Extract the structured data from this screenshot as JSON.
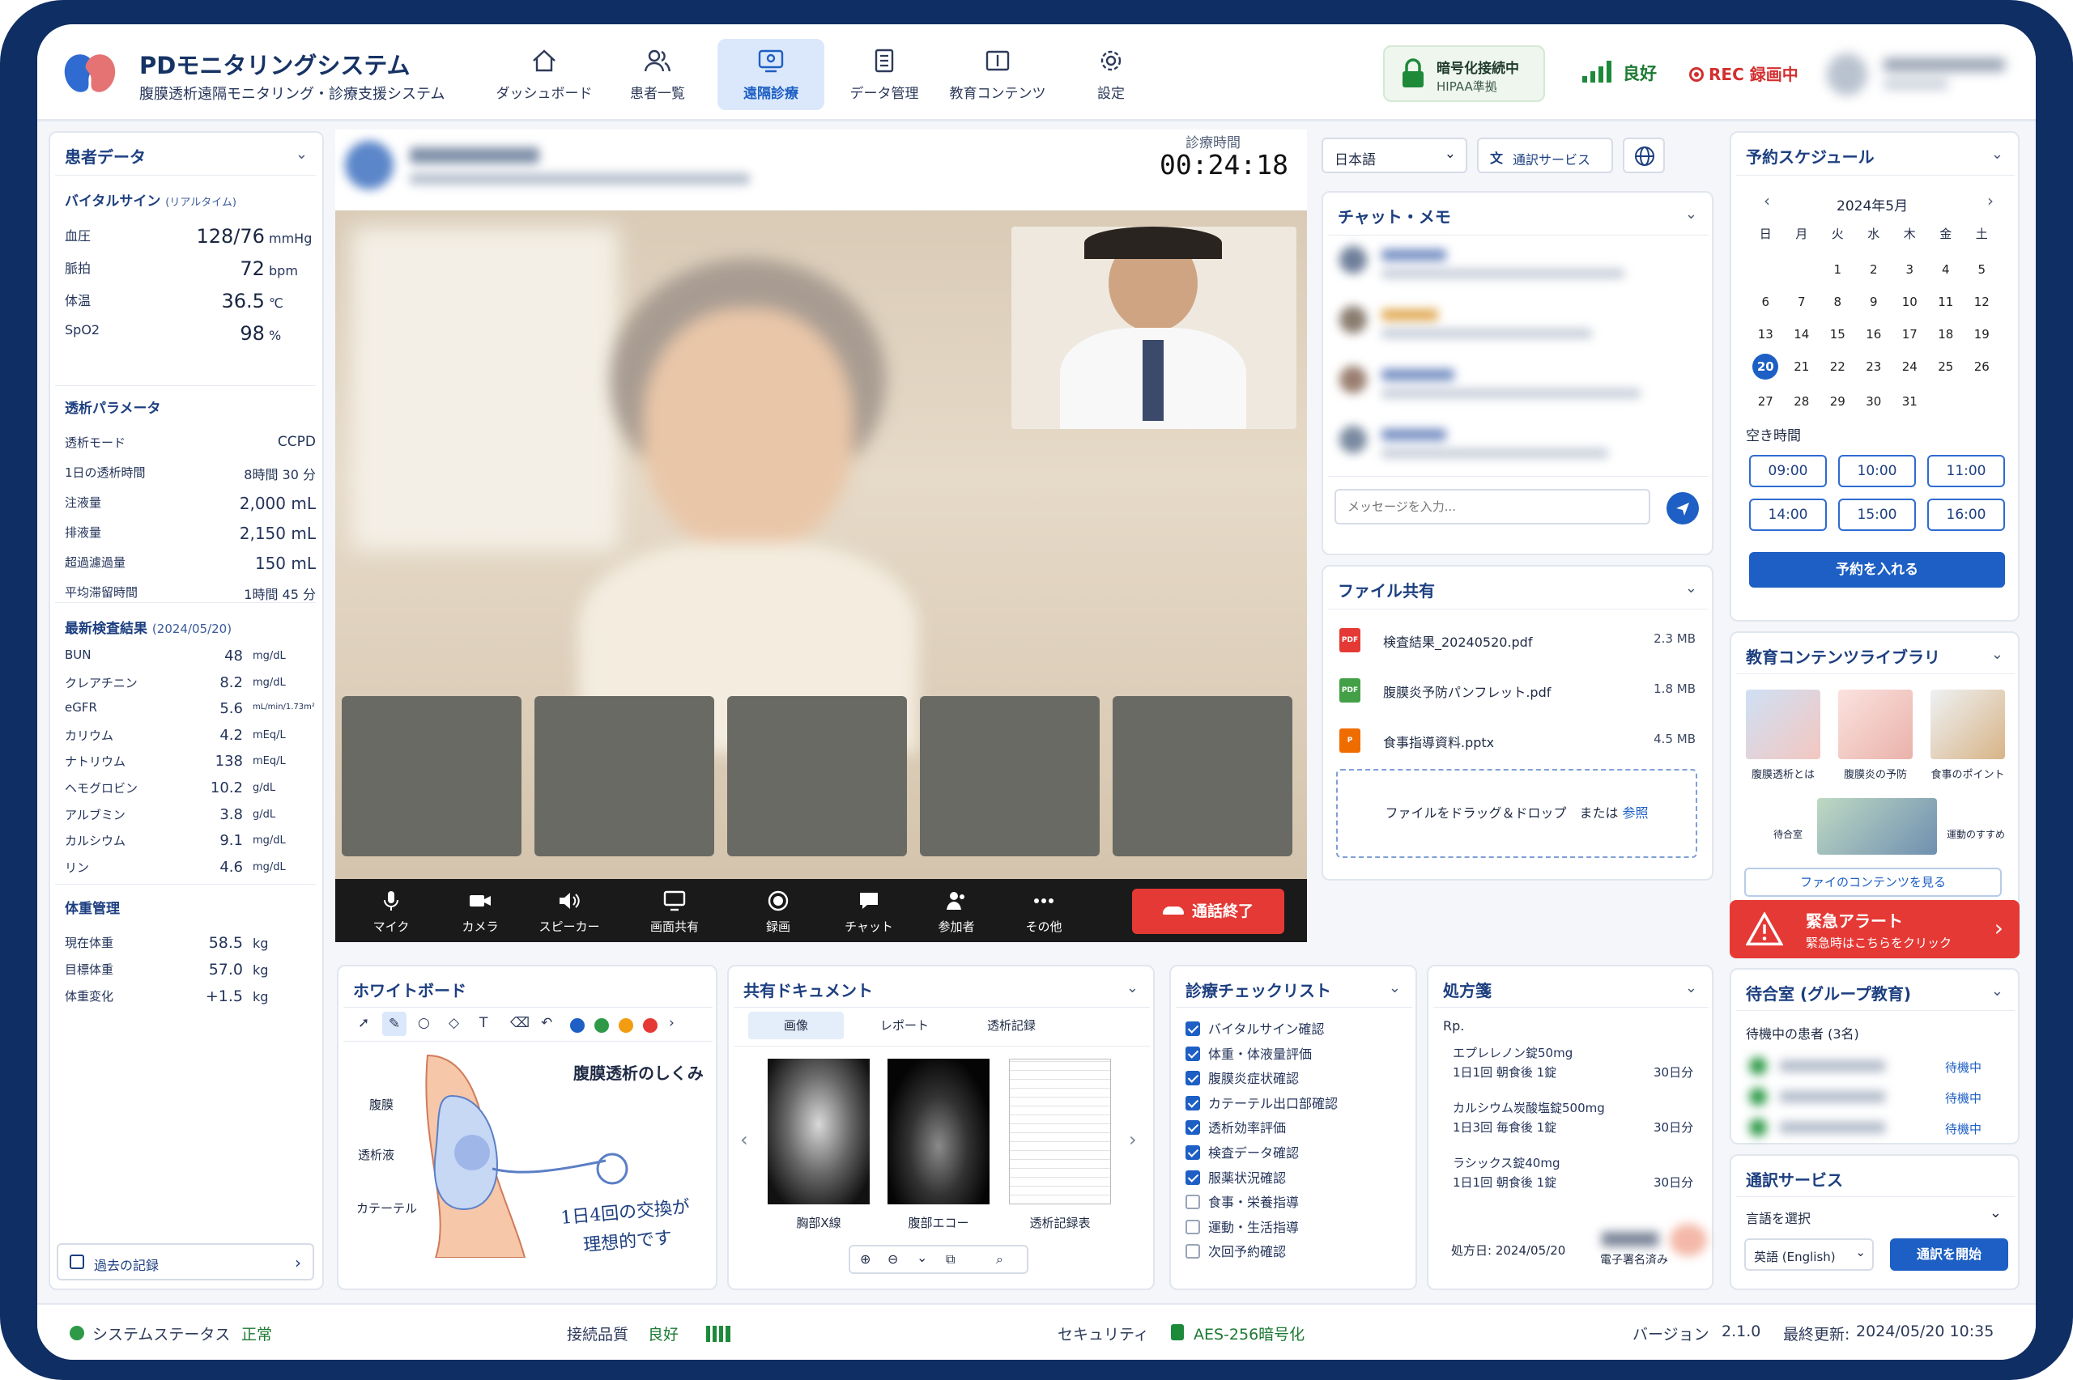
{
  "header": {
    "app_title": "PDモニタリングシステム",
    "app_subtitle": "腹膜透析遠隔モニタリング・診療支援システム",
    "nav": [
      {
        "label": "ダッシュボード",
        "icon": "home-icon"
      },
      {
        "label": "患者一覧",
        "icon": "users-icon"
      },
      {
        "label": "遠隔診療",
        "icon": "video-icon"
      },
      {
        "label": "データ管理",
        "icon": "document-icon"
      },
      {
        "label": "教育コンテンツ",
        "icon": "book-icon"
      },
      {
        "label": "設定",
        "icon": "gear-icon"
      }
    ],
    "active_nav": "遠隔診療",
    "secure_title": "暗号化接続中",
    "secure_sub": "HIPAA準拠",
    "quality_label": "良好",
    "rec_label": "REC 録画中"
  },
  "patient": {
    "title": "患者データ",
    "vitals_title": "バイタルサイン",
    "vitals_tag": "(リアルタイム)",
    "vitals": [
      {
        "label": "血圧",
        "value": "128/76",
        "unit": "mmHg"
      },
      {
        "label": "脈拍",
        "value": "72",
        "unit": "bpm"
      },
      {
        "label": "体温",
        "value": "36.5",
        "unit": "℃"
      },
      {
        "label": "SpO2",
        "value": "98",
        "unit": "%"
      }
    ],
    "dialysis_title": "透析パラメータ",
    "dialysis": [
      {
        "label": "透析モード",
        "value": "CCPD"
      },
      {
        "label": "1日の透析時間",
        "value": "8時間 30 分"
      },
      {
        "label": "注液量",
        "value": "2,000 mL"
      },
      {
        "label": "排液量",
        "value": "2,150 mL"
      },
      {
        "label": "超過濾過量",
        "value": "150 mL"
      },
      {
        "label": "平均滞留時間",
        "value": "1時間 45 分"
      }
    ],
    "labs_title": "最新検査結果",
    "labs_date": "(2024/05/20)",
    "labs": [
      {
        "label": "BUN",
        "value": "48",
        "unit": "mg/dL"
      },
      {
        "label": "クレアチニン",
        "value": "8.2",
        "unit": "mg/dL"
      },
      {
        "label": "eGFR",
        "value": "5.6",
        "unit": "mL/min/1.73m²"
      },
      {
        "label": "カリウム",
        "value": "4.2",
        "unit": "mEq/L"
      },
      {
        "label": "ナトリウム",
        "value": "138",
        "unit": "mEq/L"
      },
      {
        "label": "ヘモグロビン",
        "value": "10.2",
        "unit": "g/dL"
      },
      {
        "label": "アルブミン",
        "value": "3.8",
        "unit": "g/dL"
      },
      {
        "label": "カルシウム",
        "value": "9.1",
        "unit": "mg/dL"
      },
      {
        "label": "リン",
        "value": "4.6",
        "unit": "mg/dL"
      }
    ],
    "weight_title": "体重管理",
    "weight": [
      {
        "label": "現在体重",
        "value": "58.5",
        "unit": "kg"
      },
      {
        "label": "目標体重",
        "value": "57.0",
        "unit": "kg"
      },
      {
        "label": "体重変化",
        "value": "+1.5",
        "unit": "kg"
      }
    ],
    "history_button": "過去の記録"
  },
  "call": {
    "time_label": "診療時間",
    "time": "00:24:18",
    "controls": [
      "マイク",
      "カメラ",
      "スピーカー",
      "画面共有",
      "録画",
      "チャット",
      "参加者",
      "その他"
    ],
    "end_label": "通話終了"
  },
  "language": {
    "selected": "日本語",
    "interpret_button": "通訳サービス"
  },
  "chat": {
    "title": "チャット・メモ",
    "placeholder": "メッセージを入力..."
  },
  "files": {
    "title": "ファイル共有",
    "items": [
      {
        "name": "検査結果_20240520.pdf",
        "size": "2.3 MB",
        "type": "PDF",
        "color": "#e53935"
      },
      {
        "name": "腹膜炎予防パンフレット.pdf",
        "size": "1.8 MB",
        "type": "PDF",
        "color": "#43a047"
      },
      {
        "name": "食事指導資料.pptx",
        "size": "4.5 MB",
        "type": "P",
        "color": "#ef6c00"
      }
    ],
    "drop_text": "ファイルをドラッグ＆ドロップ　または",
    "drop_link": "参照"
  },
  "schedule": {
    "title": "予約スケジュール",
    "month": "2024年5月",
    "weekdays": [
      "日",
      "月",
      "火",
      "水",
      "木",
      "金",
      "土"
    ],
    "days": [
      "",
      "",
      "1",
      "2",
      "3",
      "4",
      "5",
      "6",
      "7",
      "8",
      "9",
      "10",
      "11",
      "12",
      "13",
      "14",
      "15",
      "16",
      "17",
      "18",
      "19",
      "20",
      "21",
      "22",
      "23",
      "24",
      "25",
      "26",
      "27",
      "28",
      "29",
      "30",
      "31"
    ],
    "today": "20",
    "free_title": "空き時間",
    "slots": [
      "09:00",
      "10:00",
      "11:00",
      "14:00",
      "15:00",
      "16:00"
    ],
    "book_button": "予約を入れる"
  },
  "library": {
    "title": "教育コンテンツライブラリ",
    "items": [
      "腹膜透析とは",
      "腹膜炎の予防",
      "食事のポイント"
    ],
    "extra_left": "待合室",
    "extra_right": "運動のすすめ",
    "more_button": "ファイのコンテンツを見る"
  },
  "alert": {
    "title": "緊急アラート",
    "sub": "緊急時はこちらをクリック"
  },
  "waiting": {
    "title": "待合室 (グループ教育)",
    "count": "待機中の患者 (3名)",
    "status": "待機中"
  },
  "interpret": {
    "title": "通訳サービス",
    "select_label": "言語を選択",
    "selected": "英語 (English)",
    "start_button": "通訳を開始"
  },
  "whiteboard": {
    "title": "ホワイトボード",
    "heading": "腹膜透析のしくみ",
    "labels": [
      "腹膜",
      "透析液",
      "カテーテル"
    ],
    "note_line1": "1日4回の交換が",
    "note_line2": "理想的です"
  },
  "shared": {
    "title": "共有ドキュメント",
    "tabs": [
      "画像",
      "レポート",
      "透析記録"
    ],
    "images": [
      "胸部X線",
      "腹部エコー",
      "透析記録表"
    ]
  },
  "checklist": {
    "title": "診療チェックリスト",
    "items": [
      {
        "label": "バイタルサイン確認",
        "checked": true
      },
      {
        "label": "体重・体液量評価",
        "checked": true
      },
      {
        "label": "腹膜炎症状確認",
        "checked": true
      },
      {
        "label": "カテーテル出口部確認",
        "checked": true
      },
      {
        "label": "透析効率評価",
        "checked": true
      },
      {
        "label": "検査データ確認",
        "checked": true
      },
      {
        "label": "服薬状況確認",
        "checked": true
      },
      {
        "label": "食事・栄養指導",
        "checked": false
      },
      {
        "label": "運動・生活指導",
        "checked": false
      },
      {
        "label": "次回予約確認",
        "checked": false
      }
    ]
  },
  "rx": {
    "title": "処方箋",
    "rp": "Rp.",
    "items": [
      {
        "name": "エプレレノン錠50mg",
        "dose": "1日1回 朝食後 1錠",
        "days": "30日分"
      },
      {
        "name": "カルシウム炭酸塩錠500mg",
        "dose": "1日3回 毎食後 1錠",
        "days": "30日分"
      },
      {
        "name": "ラシックス錠40mg",
        "dose": "1日1回 朝食後 1錠",
        "days": "30日分"
      }
    ],
    "date": "処方日: 2024/05/20",
    "signed": "電子署名済み"
  },
  "status": {
    "system_label": "システムステータス",
    "system_value": "正常",
    "conn_label": "接続品質",
    "conn_value": "良好",
    "sec_label": "セキュリティ",
    "sec_value": "AES-256暗号化",
    "version_label": "バージョン",
    "version_value": "2.1.0",
    "updated_label": "最終更新:",
    "updated_value": "2024/05/20 10:35"
  }
}
